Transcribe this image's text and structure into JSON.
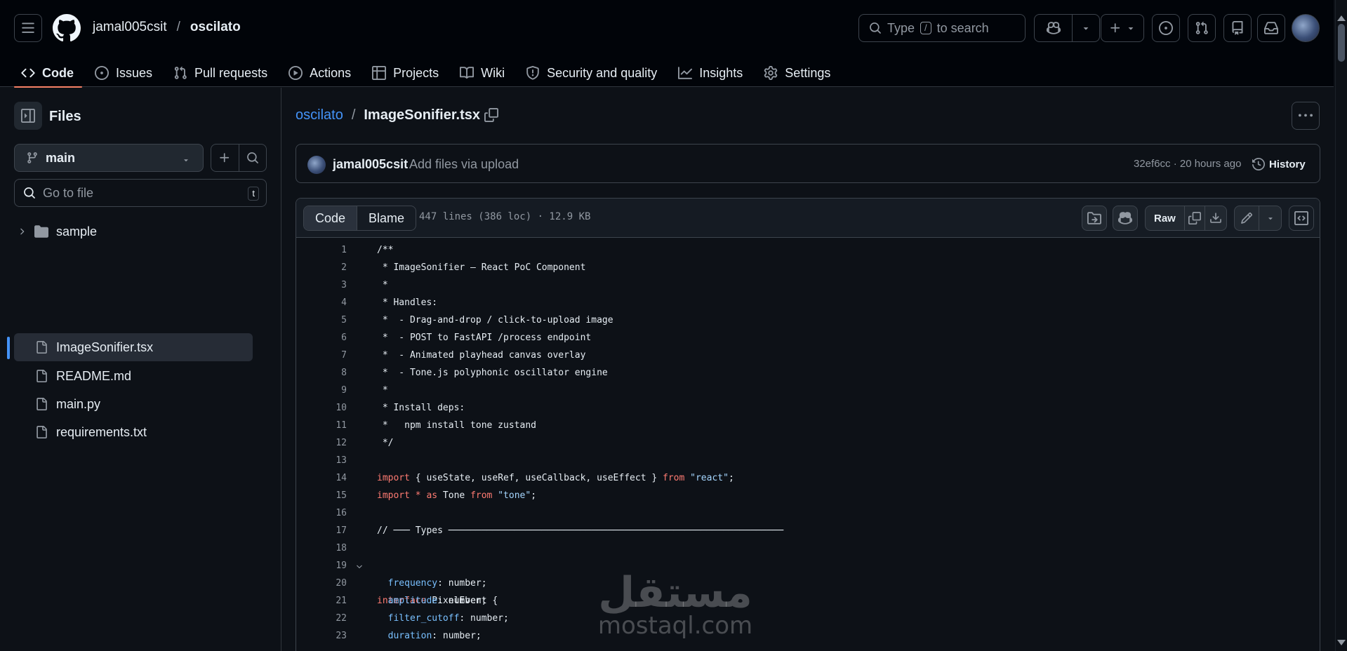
{
  "header": {
    "owner": "jamal005csit",
    "separator": "/",
    "repo": "oscilato",
    "search_prefix": "Type",
    "search_key": "/",
    "search_suffix": "to search"
  },
  "nav": {
    "tabs": [
      {
        "label": "Code",
        "icon": "code-icon"
      },
      {
        "label": "Issues",
        "icon": "issue-opened-icon"
      },
      {
        "label": "Pull requests",
        "icon": "git-pull-request-icon"
      },
      {
        "label": "Actions",
        "icon": "play-icon"
      },
      {
        "label": "Projects",
        "icon": "table-icon"
      },
      {
        "label": "Wiki",
        "icon": "book-icon"
      },
      {
        "label": "Security and quality",
        "icon": "shield-icon"
      },
      {
        "label": "Insights",
        "icon": "graph-icon"
      },
      {
        "label": "Settings",
        "icon": "gear-icon"
      }
    ]
  },
  "sidebar": {
    "title": "Files",
    "branch": "main",
    "goto_placeholder": "Go to file",
    "goto_key": "t",
    "tree": [
      {
        "label": "sample",
        "type": "folder"
      },
      {
        "label": "ImageSonifier.tsx",
        "type": "file",
        "selected": true
      },
      {
        "label": "README.md",
        "type": "file"
      },
      {
        "label": "main.py",
        "type": "file"
      },
      {
        "label": "requirements.txt",
        "type": "file"
      }
    ]
  },
  "main": {
    "crumb_repo": "oscilato",
    "crumb_sep": "/",
    "crumb_file": "ImageSonifier.tsx",
    "commit": {
      "author": "jamal005csit",
      "message": "Add files via upload",
      "meta": "32ef6cc · 20 hours ago",
      "history_label": "History"
    },
    "file": {
      "tab_code": "Code",
      "tab_blame": "Blame",
      "meta": "447 lines (386 loc) · 12.9 KB",
      "raw_label": "Raw"
    }
  },
  "code_lines": [
    "1",
    "2",
    "3",
    "4",
    "5",
    "6",
    "7",
    "8",
    "9",
    "10",
    "11",
    "12",
    "13",
    "14",
    "15",
    "16",
    "17",
    "18",
    "19",
    "20",
    "21",
    "22",
    "23"
  ],
  "code": {
    "l1": "/**",
    "l2": " * ImageSonifier — React PoC Component",
    "l3": " *",
    "l4": " * Handles:",
    "l5": " *  - Drag-and-drop / click-to-upload image",
    "l6": " *  - POST to FastAPI /process endpoint",
    "l7": " *  - Animated playhead canvas overlay",
    "l8": " *  - Tone.js polyphonic oscillator engine",
    "l9": " *",
    "l10": " * Install deps:",
    "l11": " *   npm install tone zustand",
    "l12": " */",
    "l14_kw": "import",
    "l14_mid": " { useState, useRef, useCallback, useEffect } ",
    "l14_from": "from",
    "l14_str": " \"react\"",
    "l14_end": ";",
    "l15_kw": "import",
    "l15_star": " * ",
    "l15_as": "as",
    "l15_name": " Tone ",
    "l15_from": "from",
    "l15_str": " \"tone\"",
    "l15_end": ";",
    "l17": "// ─── Types ─────────────────────────────────────────────────────────────",
    "l19_kw": "interface",
    "l19_rest": " PixelEvent {",
    "l20_prop": "  frequency",
    "l20_rest": ": number;",
    "l21_prop": "  amplitude",
    "l21_rest": ": number;",
    "l22_prop": "  filter_cutoff",
    "l22_rest": ": number;",
    "l23_prop": "  duration",
    "l23_rest": ": number;"
  },
  "watermark": {
    "arabic": "مستقل",
    "latin": "mostaql.com"
  }
}
